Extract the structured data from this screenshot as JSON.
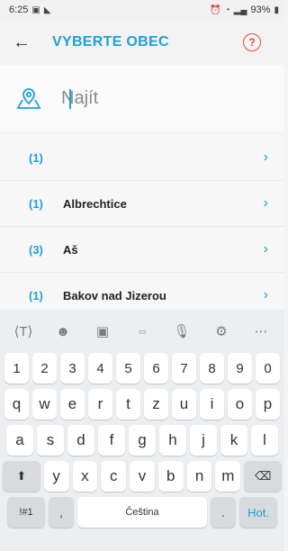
{
  "status": {
    "time": "6:25",
    "battery": "93%"
  },
  "app_bar": {
    "title": "VYBERTE OBEC",
    "help": "?"
  },
  "search": {
    "placeholder": "Najít",
    "value": ""
  },
  "list": [
    {
      "count": "(1)",
      "name": ""
    },
    {
      "count": "(1)",
      "name": "Albrechtice"
    },
    {
      "count": "(3)",
      "name": "Aš"
    },
    {
      "count": "(1)",
      "name": "Bakov nad Jizerou"
    }
  ],
  "keyboard": {
    "row_numbers": [
      "1",
      "2",
      "3",
      "4",
      "5",
      "6",
      "7",
      "8",
      "9",
      "0"
    ],
    "row_1": [
      "q",
      "w",
      "e",
      "r",
      "t",
      "z",
      "u",
      "i",
      "o",
      "p"
    ],
    "row_2": [
      "a",
      "s",
      "d",
      "f",
      "g",
      "h",
      "j",
      "k",
      "l"
    ],
    "row_3": [
      "y",
      "x",
      "c",
      "v",
      "b",
      "n",
      "m"
    ],
    "symbols_key": "!#1",
    "comma_key": ",",
    "space_label": "Čeština",
    "period_key": ".",
    "action_key": "Hot."
  },
  "colors": {
    "accent": "#1f9fd6",
    "help": "#e5493a"
  }
}
